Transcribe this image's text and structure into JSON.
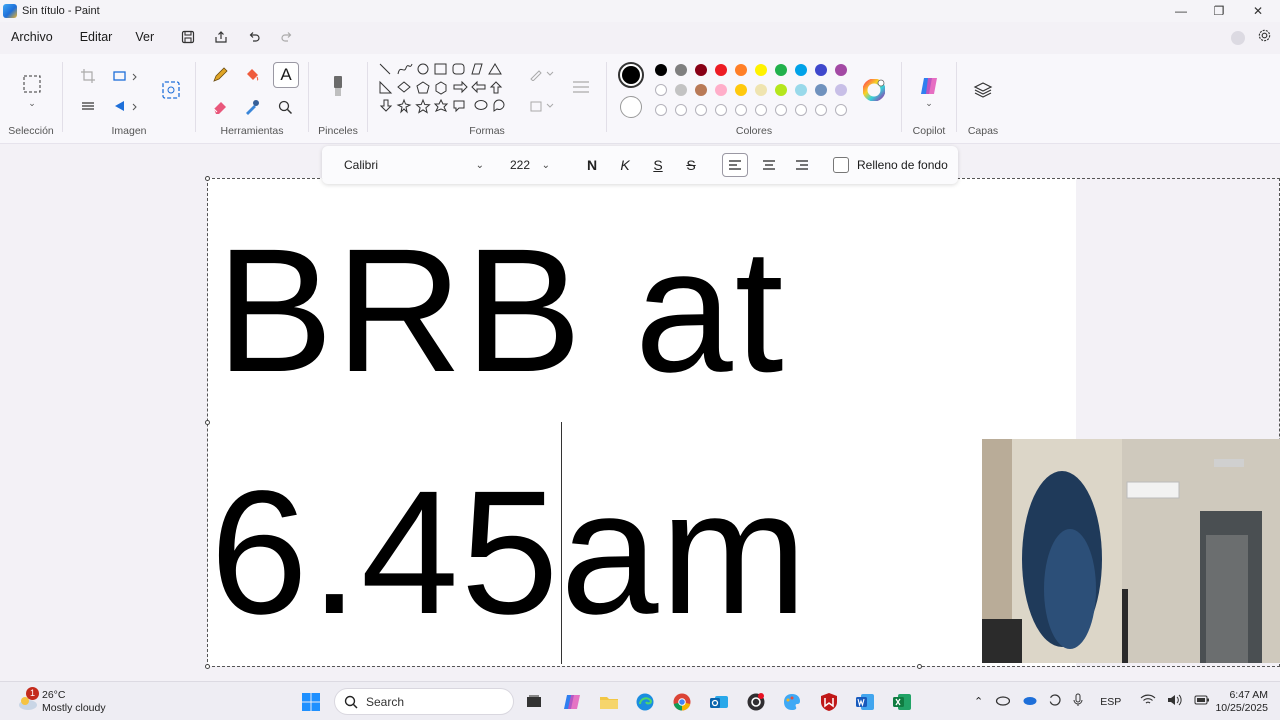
{
  "window": {
    "title": "Sin título - Paint",
    "minimize": "—",
    "restore": "❐",
    "close": "✕"
  },
  "menu": {
    "items": [
      "Archivo",
      "Editar",
      "Ver"
    ]
  },
  "ribbon": {
    "groups": {
      "selection": "Selección",
      "image": "Imagen",
      "tools": "Herramientas",
      "brushes": "Pinceles",
      "shapes": "Formas",
      "colors": "Colores",
      "copilot": "Copilot",
      "layers": "Capas"
    },
    "palette": {
      "row1": [
        "#000000",
        "#7f7f7f",
        "#880015",
        "#ed1c24",
        "#ff7f27",
        "#fff200",
        "#22b14c",
        "#00a2e8",
        "#3f48cc",
        "#a349a4"
      ],
      "row2": [
        "#ffffff",
        "#c3c3c3",
        "#b97a57",
        "#ffaec9",
        "#ffc90e",
        "#efe4b0",
        "#b5e61d",
        "#99d9ea",
        "#7092be",
        "#c8bfe7"
      ]
    }
  },
  "text_toolbar": {
    "font": "Calibri",
    "size": "222",
    "bold": "N",
    "italic": "K",
    "underline": "S",
    "strikethrough": "S",
    "background_fill": "Relleno de fondo"
  },
  "canvas": {
    "line1": "BRB at",
    "line2": "6.45am"
  },
  "taskbar": {
    "weather": {
      "badge": "1",
      "temp": "26°C",
      "condition": "Mostly cloudy"
    },
    "search_placeholder": "Search",
    "language": "ESP",
    "time": "6:47 AM",
    "date": "10/25/2025"
  }
}
